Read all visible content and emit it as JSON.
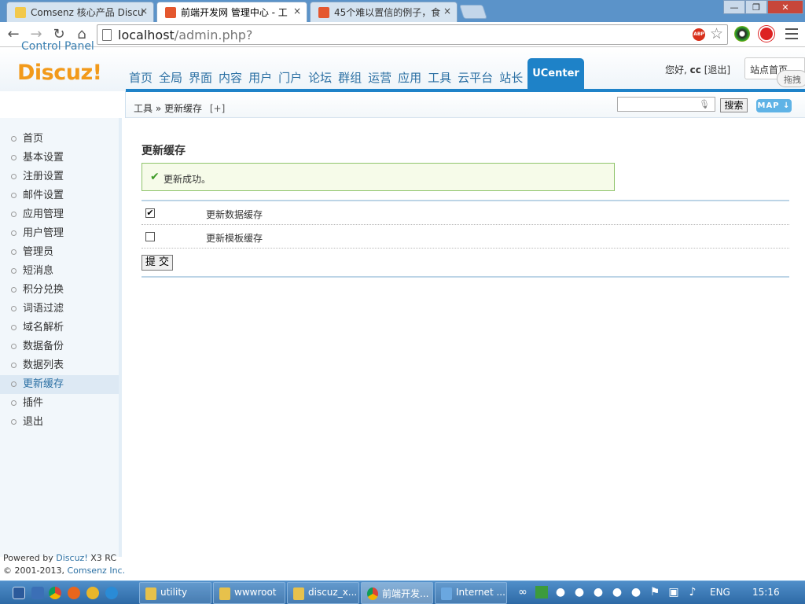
{
  "browser": {
    "tabs": [
      {
        "title": "Comsenz 核心产品 Discu",
        "active": false
      },
      {
        "title": "前端开发网 管理中心 - 工",
        "active": true
      },
      {
        "title": "45个难以置信的例子，食",
        "active": false
      }
    ],
    "close_glyph": "×",
    "url_host": "localhost",
    "url_path": "/admin.php?",
    "adblock_label": "ABP",
    "window_controls": {
      "minimize": "—",
      "maximize": "❐",
      "close": "✕"
    }
  },
  "header": {
    "logo": "Discuz!",
    "logo_sub": "Control Panel",
    "nav": [
      "首页",
      "全局",
      "界面",
      "内容",
      "用户",
      "门户",
      "论坛",
      "群组",
      "运营",
      "应用",
      "工具",
      "云平台",
      "站长"
    ],
    "nav_active": "UCenter",
    "greeting": "您好,",
    "username": "cc",
    "logout": "[退出]",
    "site_home": "站点首页",
    "drag_hint": "拖拽"
  },
  "breadcrumb": {
    "section": "工具",
    "sep": "»",
    "page": "更新缓存",
    "add": "[+]"
  },
  "search": {
    "button": "搜索",
    "map": "MAP ↓"
  },
  "sidebar": {
    "items": [
      "首页",
      "基本设置",
      "注册设置",
      "邮件设置",
      "应用管理",
      "用户管理",
      "管理员",
      "短消息",
      "积分兑换",
      "词语过滤",
      "域名解析",
      "数据备份",
      "数据列表",
      "更新缓存",
      "插件",
      "退出"
    ],
    "active_index": 13,
    "powered_prefix": "Powered by",
    "powered_product": "Discuz!",
    "powered_version": "X3 RC",
    "copyright_prefix": "© 2001-2013,",
    "copyright_company": "Comsenz Inc."
  },
  "main": {
    "title": "更新缓存",
    "success_message": "更新成功。",
    "options": [
      {
        "label": "更新数据缓存",
        "checked": true
      },
      {
        "label": "更新模板缓存",
        "checked": false
      }
    ],
    "check_glyph": "✔",
    "submit": "提 交"
  },
  "taskbar": {
    "items": [
      {
        "label": "utility"
      },
      {
        "label": "wwwroot"
      },
      {
        "label": "discuz_x..."
      },
      {
        "label": "前端开发..."
      },
      {
        "label": "Internet ..."
      }
    ],
    "active_index": 3,
    "lang": "ENG",
    "time": "15:16"
  },
  "colors": {
    "accent_blue": "#1e82c8",
    "logo_orange": "#f29a1b",
    "success_border": "#8fc46b"
  }
}
